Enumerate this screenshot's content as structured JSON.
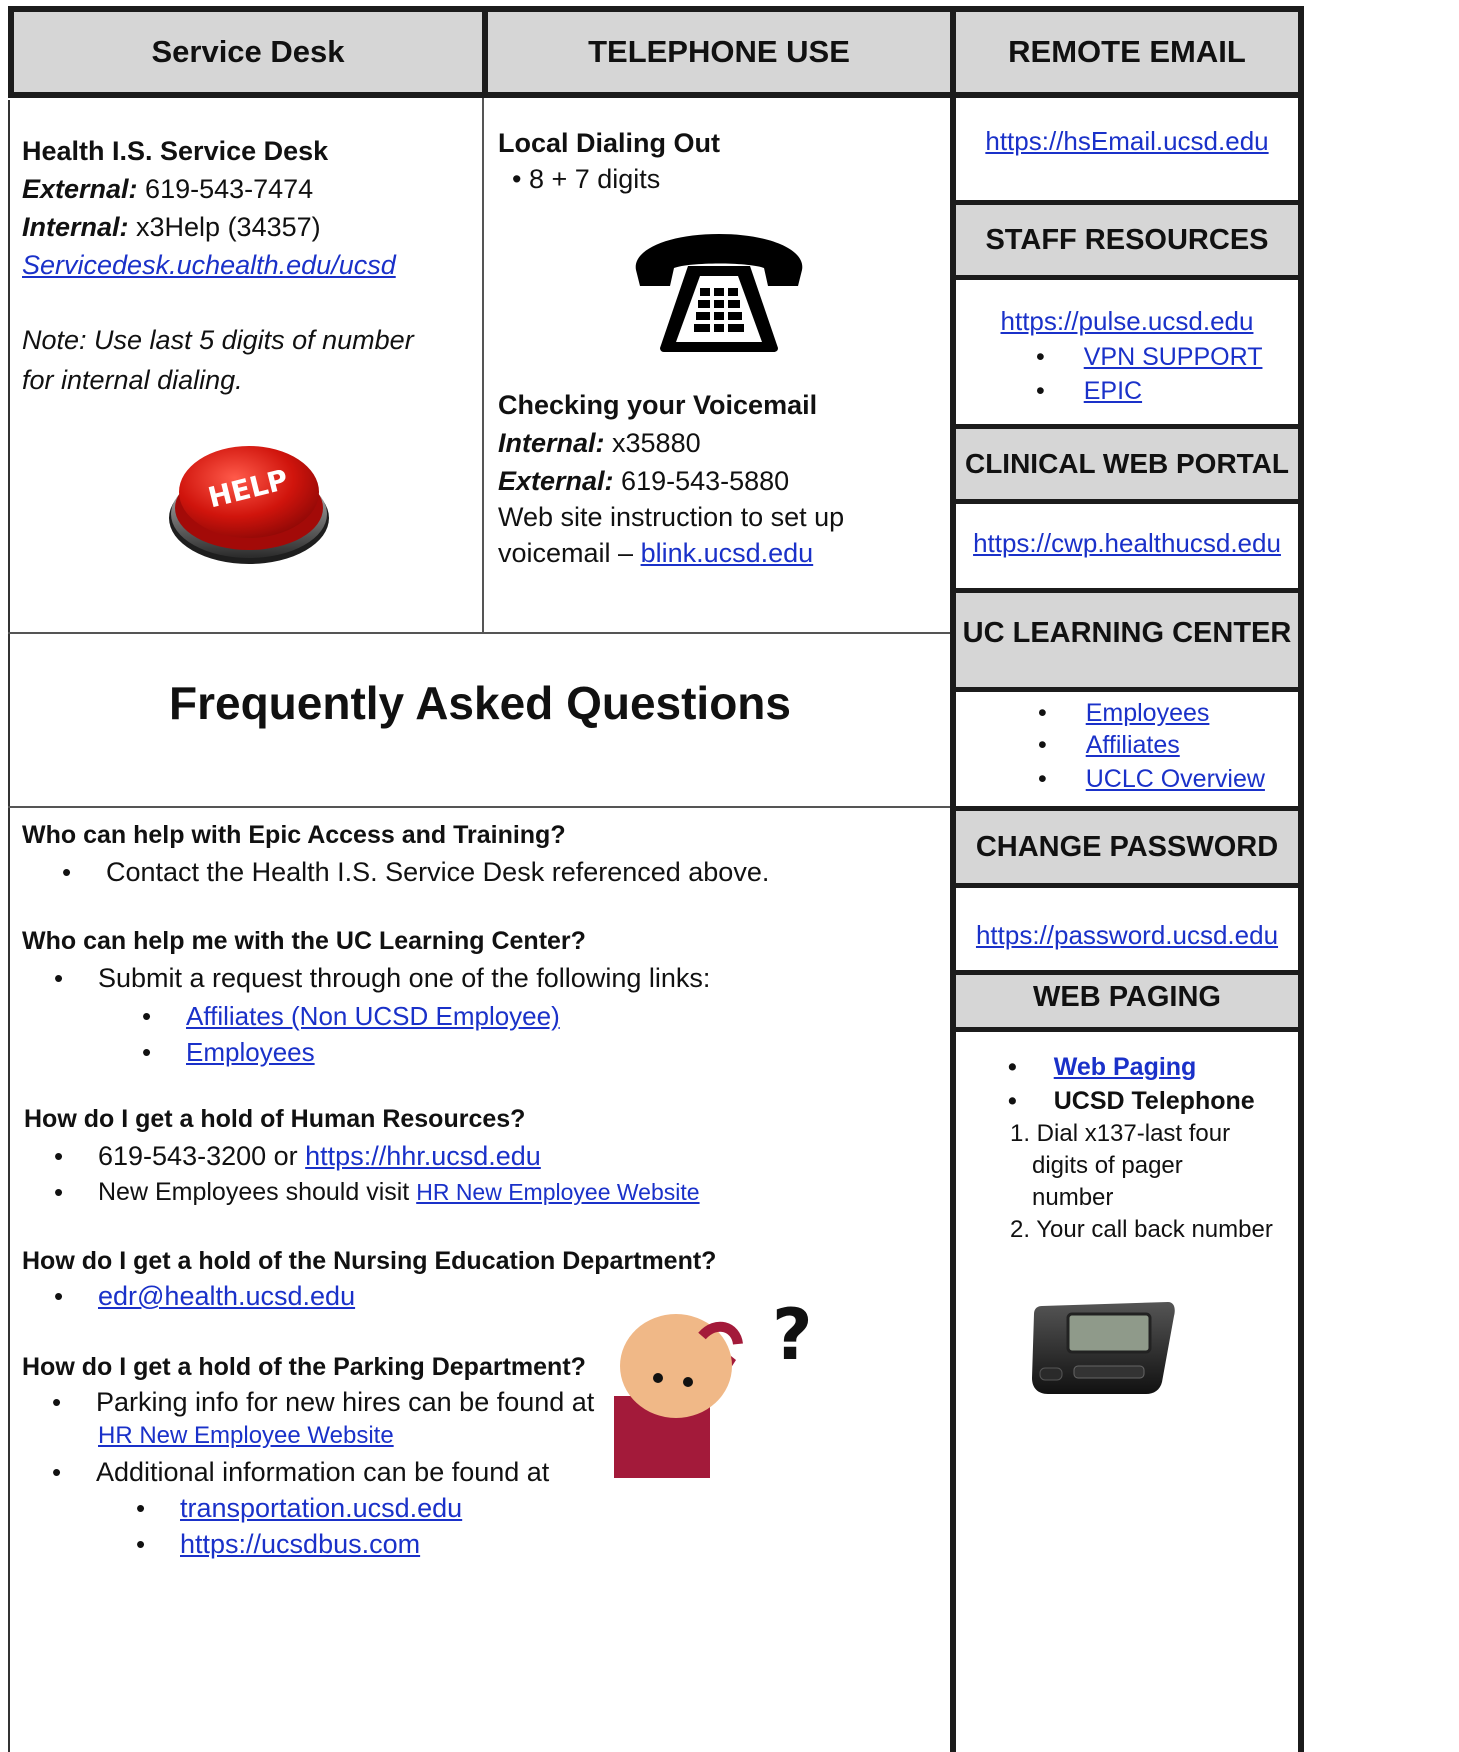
{
  "headers": {
    "service_desk": "Service Desk",
    "telephone_use": "TELEPHONE  USE",
    "remote_email": "REMOTE  EMAIL",
    "staff_resources": "STAFF RESOURCES",
    "clinical_web_portal": "CLINICAL WEB PORTAL",
    "uc_learning_center": "UC LEARNING CENTER",
    "change_password": "CHANGE  PASSWORD",
    "web_paging": "WEB PAGING"
  },
  "service_desk": {
    "title": "Health I.S. Service Desk",
    "external_label": "External:",
    "external_value": " 619-543-7474",
    "internal_label": "Internal:",
    "internal_value": " x3Help (34357)",
    "link": "Servicedesk.uchealth.edu/ucsd",
    "note": "Note: Use last 5 digits of number for internal dialing.",
    "button_text": "HELP"
  },
  "telephone": {
    "local_title": "Local Dialing Out",
    "local_bullet": "8 + 7 digits",
    "voicemail_title": "Checking your Voicemail",
    "internal_label": "Internal:",
    "internal_value": " x35880",
    "external_label": "External:",
    "external_value": " 619-543-5880",
    "instruction_line1": "Web site instruction to set up",
    "instruction_line2": "voicemail – ",
    "instruction_link": "blink.ucsd.edu"
  },
  "sidebar": {
    "remote_email_link": "https://hsEmail.ucsd.edu",
    "staff_link": "https://pulse.ucsd.edu",
    "staff_items": [
      "VPN SUPPORT",
      "EPIC"
    ],
    "cwp_link": "https://cwp.healthucsd.edu",
    "uclc_items": [
      "Employees",
      "Affiliates",
      "UCLC Overview"
    ],
    "password_link": "https://password.ucsd.edu",
    "paging_items": [
      "Web Paging",
      "UCSD Telephone"
    ],
    "paging_steps": [
      "1. Dial x137-last four",
      "digits of pager",
      "number",
      "2. Your call back number"
    ]
  },
  "faq": {
    "title": "Frequently Asked Questions",
    "q1": "Who can help with Epic Access and Training?",
    "q1_a": "Contact the Health I.S. Service Desk referenced above.",
    "q2": "Who can help me with the UC Learning Center?",
    "q2_a": "Submit a request through one of the following links:",
    "q2_links": [
      "Affiliates (Non UCSD Employee)",
      "Employees"
    ],
    "q3": "How do I get a hold of Human Resources?",
    "q3_phone": "619-543-3200 or ",
    "q3_link": "https://hhr.ucsd.edu",
    "q3_new": "New Employees should visit ",
    "q3_new_link": "HR New Employee Website",
    "q4": "How do I get a hold of the Nursing Education Department?",
    "q4_email": "edr@health.ucsd.edu",
    "q5": "How do I get a hold of the Parking Department?",
    "q5_a1": "Parking info for new hires can be found at",
    "q5_a1_link": "HR New Employee Website",
    "q5_a2": "Additional information can be found at",
    "q5_links": [
      "transportation.ucsd.edu",
      "https://ucsdbus.com"
    ],
    "question_mark": "?"
  }
}
